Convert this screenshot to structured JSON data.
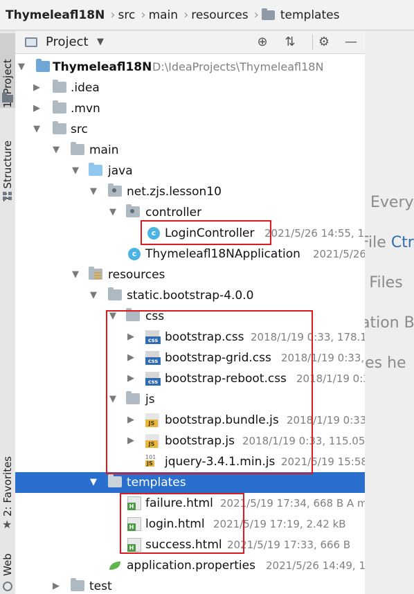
{
  "breadcrumb": [
    "Thymeleafl18N",
    "src",
    "main",
    "resources",
    "templates"
  ],
  "left_strip": {
    "project_tab": "1: Project",
    "structure_tab": "7: Structure",
    "favorites_tab": "2: Favorites",
    "web_tab": "Web"
  },
  "panel": {
    "title": "Project",
    "dropdown_icon": "chevron-down-icon",
    "toolbar_icons": [
      "locate-icon",
      "collapse-all-icon",
      "gear-icon",
      "minimize-icon"
    ]
  },
  "tree": [
    {
      "name": "Thymeleafl18N",
      "meta": "D:\\IdeaProjects\\Thymeleafl18N",
      "icon": "project-folder",
      "expanded": true
    },
    {
      "name": ".idea",
      "meta": "",
      "icon": "folder",
      "expanded": false
    },
    {
      "name": ".mvn",
      "meta": "",
      "icon": "folder",
      "expanded": false
    },
    {
      "name": "src",
      "meta": "",
      "icon": "folder",
      "expanded": true
    },
    {
      "name": "main",
      "meta": "",
      "icon": "folder",
      "expanded": true
    },
    {
      "name": "java",
      "meta": "",
      "icon": "source-folder",
      "expanded": true
    },
    {
      "name": "net.zjs.lesson10",
      "meta": "",
      "icon": "package",
      "expanded": true
    },
    {
      "name": "controller",
      "meta": "",
      "icon": "package",
      "expanded": true
    },
    {
      "name": "LoginController",
      "meta": "2021/5/26 14:55, 1.",
      "icon": "class"
    },
    {
      "name": "Thymeleafl18NApplication",
      "meta": "2021/5/26",
      "icon": "spring-class"
    },
    {
      "name": "resources",
      "meta": "",
      "icon": "resources-folder",
      "expanded": true
    },
    {
      "name": "static.bootstrap-4.0.0",
      "meta": "",
      "icon": "folder",
      "expanded": true
    },
    {
      "name": "css",
      "meta": "",
      "icon": "folder",
      "expanded": true
    },
    {
      "name": "bootstrap.css",
      "meta": "2018/1/19 0:33, 178.15",
      "icon": "css-file",
      "expanded": false
    },
    {
      "name": "bootstrap-grid.css",
      "meta": "2018/1/19 0:33,",
      "icon": "css-file",
      "expanded": false
    },
    {
      "name": "bootstrap-reboot.css",
      "meta": "2018/1/19 0:3",
      "icon": "css-file",
      "expanded": false
    },
    {
      "name": "js",
      "meta": "",
      "icon": "folder",
      "expanded": true
    },
    {
      "name": "bootstrap.bundle.js",
      "meta": "2018/1/19 0:33",
      "icon": "js-file",
      "expanded": false
    },
    {
      "name": "bootstrap.js",
      "meta": "2018/1/19 0:33, 115.05",
      "icon": "js-file",
      "expanded": false
    },
    {
      "name": "jquery-3.4.1.min.js",
      "meta": "2021/5/19 15:58",
      "icon": "min-js-file"
    },
    {
      "name": "templates",
      "meta": "",
      "icon": "folder",
      "expanded": true,
      "selected": true
    },
    {
      "name": "failure.html",
      "meta": "2021/5/19 17:34, 668 B A m",
      "icon": "html-file"
    },
    {
      "name": "login.html",
      "meta": "2021/5/19 17:19, 2.42 kB",
      "icon": "html-file"
    },
    {
      "name": "success.html",
      "meta": "2021/5/19 17:33, 666 B",
      "icon": "html-file"
    },
    {
      "name": "application.properties",
      "meta": "2021/5/26 14:49, 1",
      "icon": "properties-file"
    },
    {
      "name": "test",
      "meta": "",
      "icon": "folder",
      "expanded": false
    }
  ],
  "editor_hints": {
    "line1": "Every",
    "line2_prefix": "File ",
    "line2_accent": "Ctr",
    "line3": ": Files ",
    "line4": "ation B",
    "line5": "les he"
  },
  "colors": {
    "selection": "#2a6fcd",
    "highlight_box": "#e0171b"
  }
}
